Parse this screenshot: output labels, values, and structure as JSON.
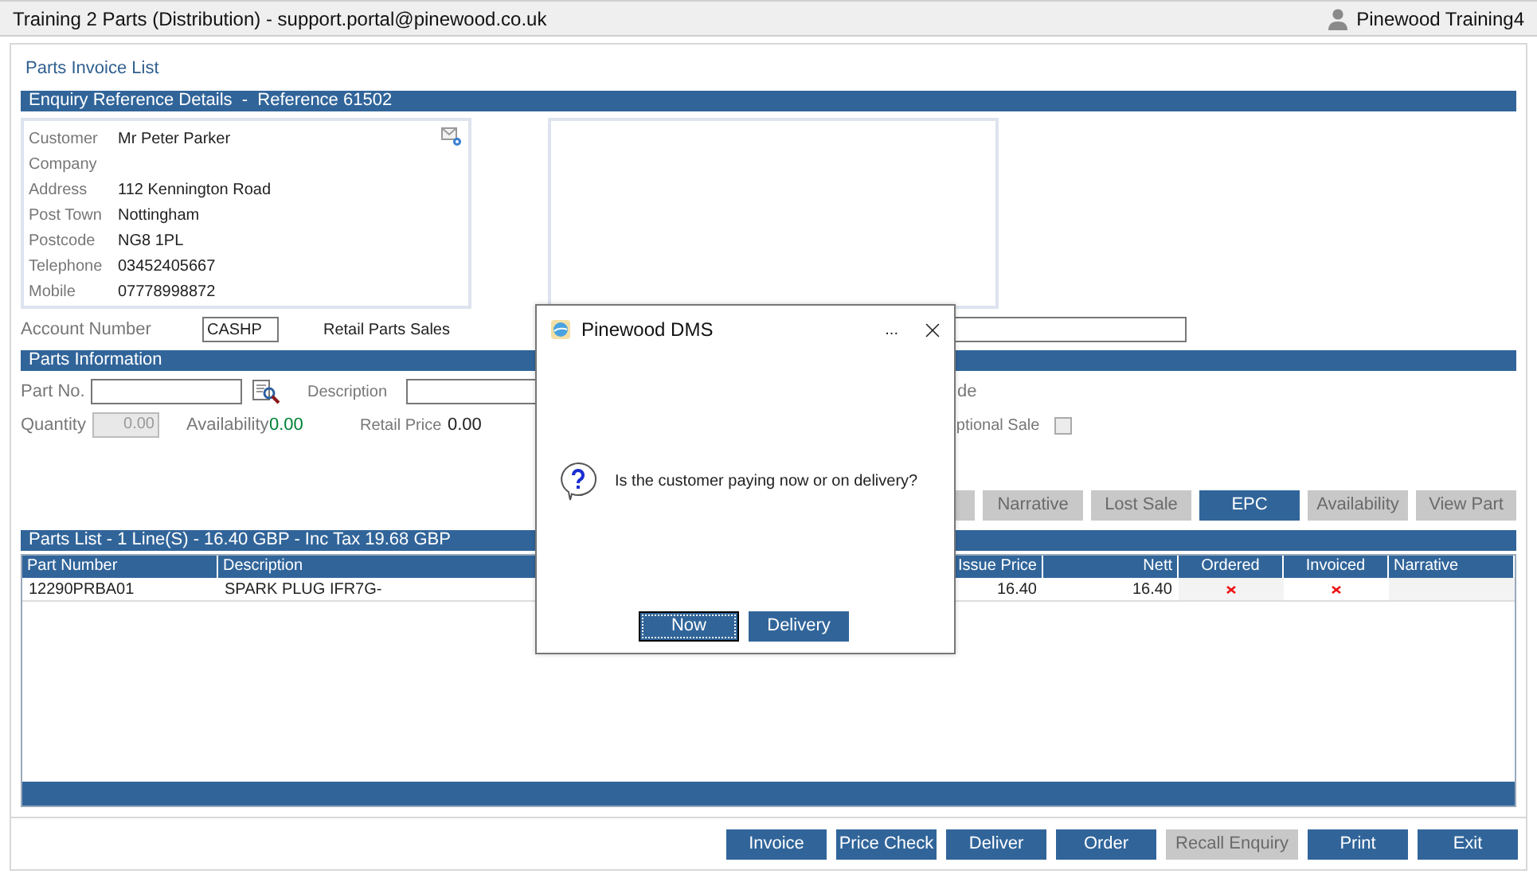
{
  "window": {
    "title": "Training 2 Parts (Distribution) - support.portal@pinewood.co.uk",
    "user": "Pinewood Training4"
  },
  "page_title": "Parts Invoice List",
  "enquiry": {
    "header": "Enquiry Reference Details  -  Reference 61502",
    "fields": [
      {
        "label": "Customer",
        "value": "Mr Peter Parker"
      },
      {
        "label": "Company"
      },
      {
        "label": "Address",
        "value": "112 Kennington Road"
      },
      {
        "label": "Post Town",
        "value": "Nottingham"
      },
      {
        "label": "Postcode",
        "value": "NG8 1PL"
      },
      {
        "label": "Telephone",
        "value": "03452405667"
      },
      {
        "label": "Mobile",
        "value": "07778998872"
      }
    ]
  },
  "account": {
    "label": "Account Number",
    "value": "CASHP",
    "name": "Retail Parts Sales"
  },
  "parts_information": {
    "header": "Parts Information",
    "part_no_label": "Part No.",
    "description_label": "Description",
    "code_label_fragment": "de",
    "quantity_label": "Quantity",
    "quantity_value": "0.00",
    "availability_label": "Availability",
    "availability_value": "0.00",
    "retail_price_label": "Retail Price",
    "retail_price_value": "0.00",
    "optional_sale_label_fragment": "ptional Sale",
    "optional_sale_checked": false
  },
  "part_buttons": [
    {
      "disabled": true
    },
    {
      "label": "Narrative",
      "disabled": true
    },
    {
      "label": "Lost Sale",
      "disabled": true
    },
    {
      "label": "EPC",
      "disabled": false
    },
    {
      "label": "Availability",
      "disabled": true
    },
    {
      "label": "View Part",
      "disabled": true
    }
  ],
  "parts_list": {
    "header": "Parts List - 1 Line(S) - 16.40 GBP - Inc Tax 19.68 GBP",
    "columns": [
      "Part Number",
      "Description",
      "Issue Price",
      "Nett",
      "Ordered",
      "Invoiced",
      "Narrative"
    ],
    "rows": [
      {
        "part_number": "12290PRBA01",
        "description": "SPARK PLUG IFR7G-",
        "issue_price": "16.40",
        "nett": "16.40",
        "ordered": false,
        "invoiced": false
      }
    ]
  },
  "footer_buttons": [
    {
      "label": "Invoice",
      "disabled": false
    },
    {
      "label": "Price Check",
      "disabled": false
    },
    {
      "label": "Deliver",
      "disabled": false
    },
    {
      "label": "Order",
      "disabled": false
    },
    {
      "label": "Recall Enquiry",
      "disabled": true
    },
    {
      "label": "Print",
      "disabled": false
    },
    {
      "label": "Exit",
      "disabled": false
    }
  ],
  "dialog": {
    "title": "Pinewood DMS",
    "more": "...",
    "message": "Is the customer paying now or on delivery?",
    "buttons": [
      {
        "label": "Now",
        "focused": true
      },
      {
        "label": "Delivery",
        "focused": false
      }
    ]
  }
}
